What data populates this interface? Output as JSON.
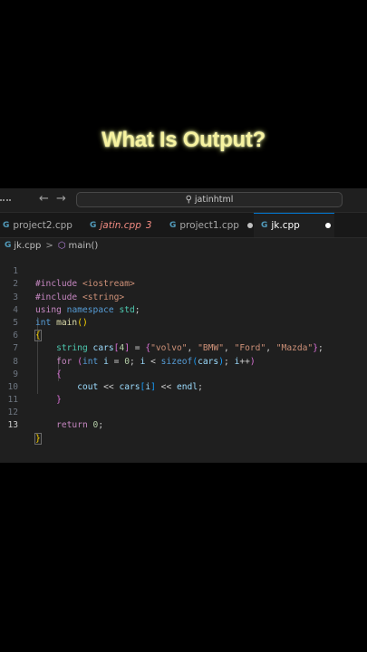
{
  "overlay_title": "What Is Output?",
  "toolbar": {
    "back_icon": "arrow-left-icon",
    "forward_icon": "arrow-right-icon",
    "search_text": "jatinhtml"
  },
  "tabs": [
    {
      "label": "project2.cpp",
      "modified": true
    },
    {
      "label": "jatin.cpp",
      "badge": "3",
      "error": true
    },
    {
      "label": "project1.cpp",
      "modified": true
    },
    {
      "label": "jk.cpp",
      "modified": true,
      "active": true
    }
  ],
  "breadcrumb": {
    "file": "jk.cpp",
    "symbol": "main()"
  },
  "line_numbers": [
    "1",
    "2",
    "3",
    "4",
    "5",
    "6",
    "7",
    "8",
    "9",
    "10",
    "11",
    "12",
    "13"
  ],
  "code": {
    "l1": {
      "directive": "#include",
      "header": "<iostream>"
    },
    "l2": {
      "directive": "#include",
      "header": "<string>"
    },
    "l3": {
      "using": "using",
      "namespace": "namespace",
      "std": "std",
      "semi": ";"
    },
    "l4": {
      "type": "int",
      "fn": "main",
      "parens": "()"
    },
    "l5": {
      "brace": "{"
    },
    "l6": {
      "type": "string",
      "var": "cars",
      "open": "[",
      "size": "4",
      "close": "]",
      "eq": " = ",
      "lbrace": "{",
      "s1": "\"volvo\"",
      "s2": "\"BMW\"",
      "s3": "\"Ford\"",
      "s4": "\"Mazda\"",
      "comma": ", ",
      "rbrace": "}",
      "semi": ";"
    },
    "l7": {
      "kw": "for",
      "lp": "(",
      "type": "int",
      "i": "i",
      "init": " = ",
      "zero": "0",
      "sc": "; ",
      "i2": "i",
      "lt": " < ",
      "sizeof": "sizeof",
      "lp2": "(",
      "cars": "cars",
      "rp2": ")",
      "sc2": "; ",
      "i3": "i",
      "inc": "++",
      "rp": ")"
    },
    "l8": {
      "brace": "{"
    },
    "l9": {
      "cout": "cout",
      "op1": " << ",
      "cars": "cars",
      "lb": "[",
      "i": "i",
      "rb": "]",
      "op2": " << ",
      "endl": "endl",
      "semi": ";"
    },
    "l10": {
      "brace": "}"
    },
    "l12": {
      "kw": "return",
      "zero": "0",
      "semi": ";"
    },
    "l13": {
      "brace": "}"
    }
  },
  "colors": {
    "editor_bg": "#1f1f1f",
    "keyword": "#569cd6",
    "string": "#ce9178",
    "accent": "#0078d4"
  }
}
